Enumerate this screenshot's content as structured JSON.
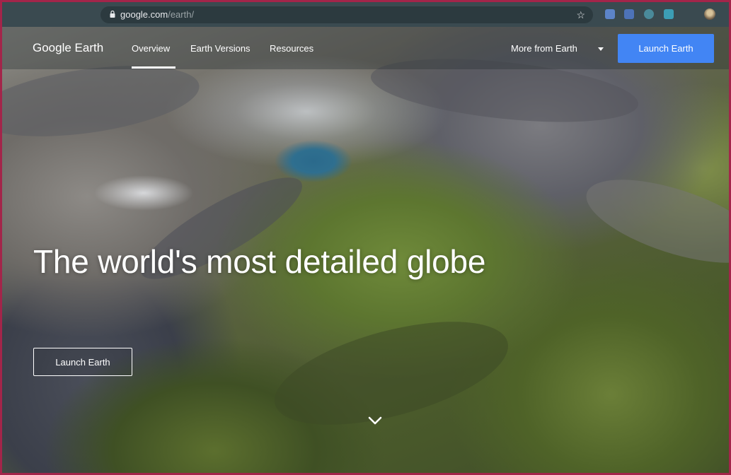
{
  "browser": {
    "url_host": "google.com",
    "url_path": "/earth/",
    "icons": {
      "lock": "lock-icon",
      "bookmark": "star-icon",
      "profile": "profile-avatar-icon"
    },
    "extensions": [
      "extension-icon",
      "extension-icon",
      "extension-icon",
      "extension-icon"
    ]
  },
  "site": {
    "brand": "Google Earth",
    "nav": {
      "overview": "Overview",
      "versions": "Earth Versions",
      "resources": "Resources"
    },
    "more_from": "More from Earth",
    "launch_top": "Launch Earth"
  },
  "hero": {
    "headline": "The world's most detailed globe",
    "launch_button": "Launch Earth",
    "scroll_icon": "chevron-down-icon"
  },
  "colors": {
    "frame_border": "#a3254a",
    "accent_blue": "#4285f4",
    "chrome_bg": "#3a4a50"
  }
}
